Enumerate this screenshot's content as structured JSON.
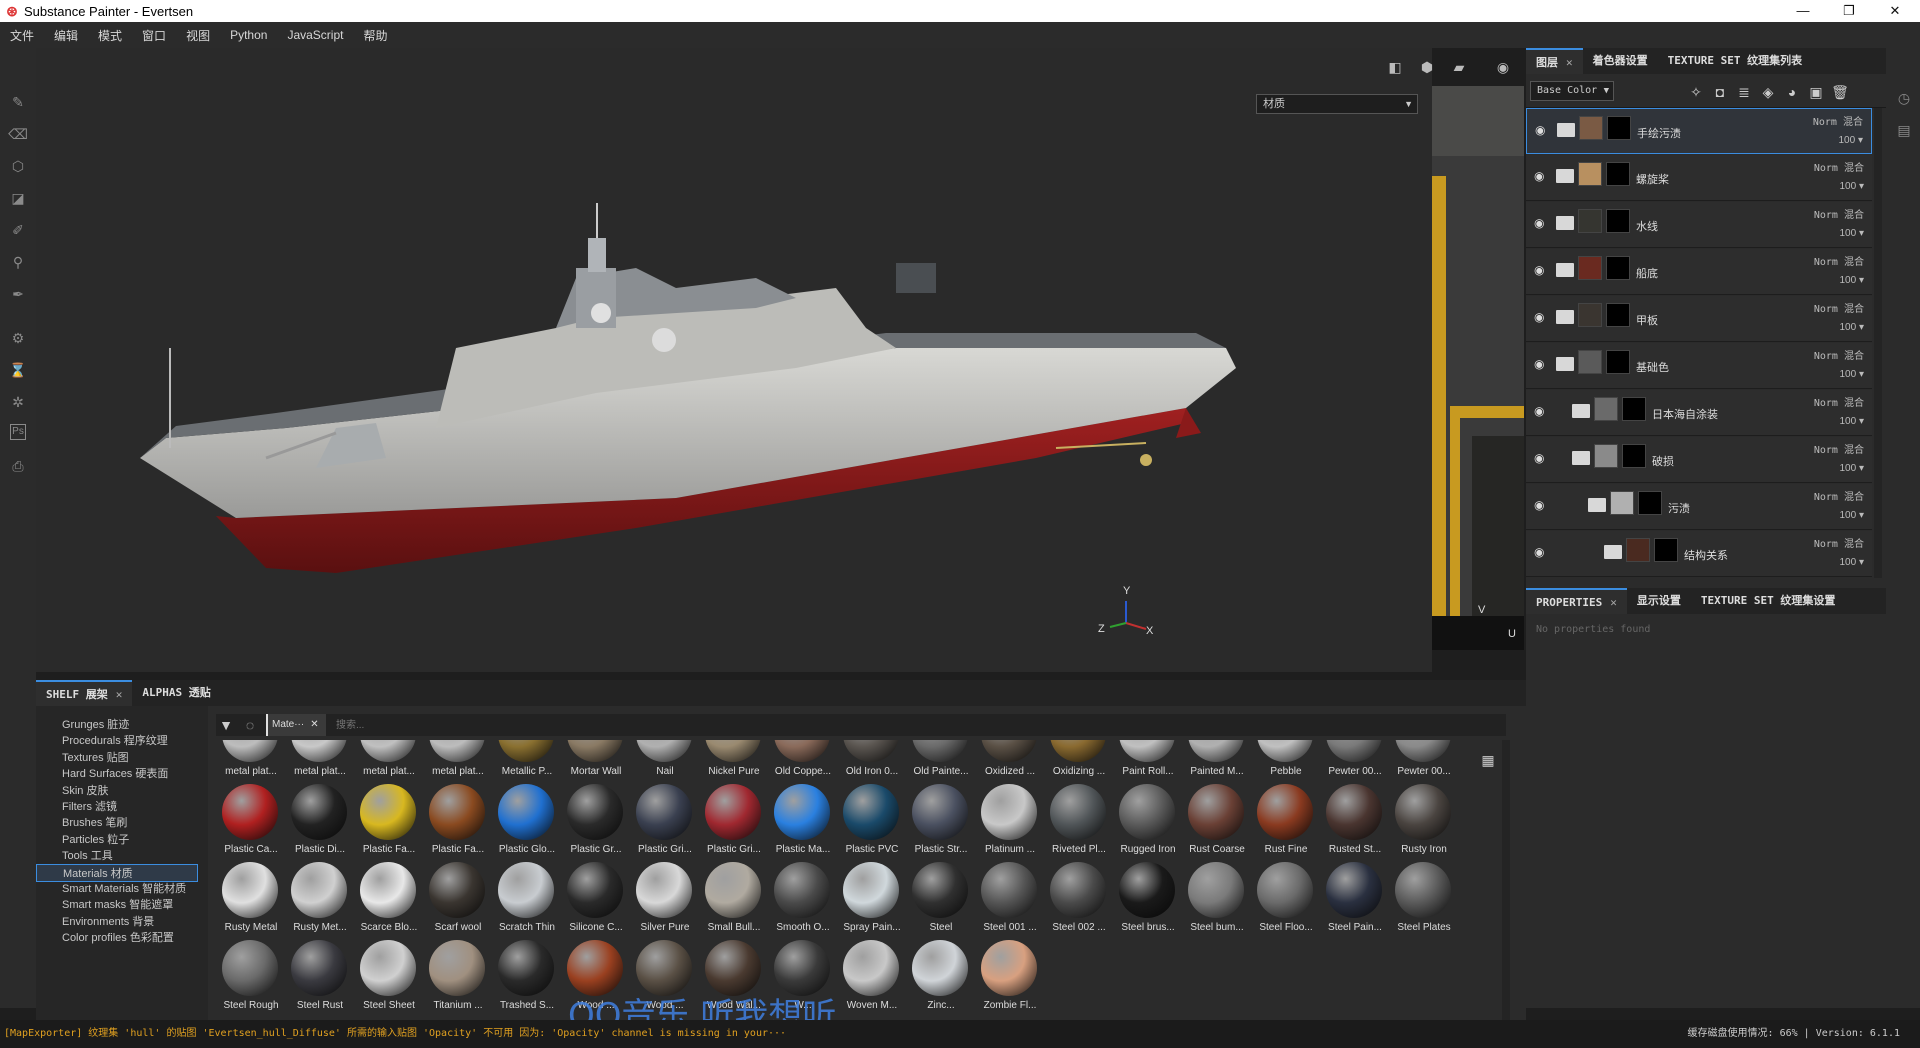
{
  "window": {
    "title": "Substance Painter - Evertsen",
    "logo": "⊛",
    "min": "—",
    "max": "❐",
    "close": "✕"
  },
  "menu": [
    "文件",
    "编辑",
    "模式",
    "窗口",
    "视图",
    "Python",
    "JavaScript",
    "帮助"
  ],
  "viewport": {
    "left_dropdown": "材质",
    "right_dropdown": "材质",
    "axis_y": "Y",
    "axis_z": "Z",
    "axis_x": "X",
    "uv_axis_v": "V",
    "uv_axis_u": "U"
  },
  "layers_panel": {
    "tabs": [
      {
        "label": "图层",
        "active": true
      },
      {
        "label": "着色器设置",
        "active": false
      },
      {
        "label": "TEXTURE SET 纹理集列表",
        "active": false
      }
    ],
    "channel": "Base Color",
    "layers": [
      {
        "name": "手绘污渍",
        "blend": "Norm",
        "blend_tag": "混合",
        "opacity": "100",
        "selected": true,
        "indent": 0,
        "thumb": "#7a5a44"
      },
      {
        "name": "螺旋桨",
        "blend": "Norm",
        "blend_tag": "混合",
        "opacity": "100",
        "selected": false,
        "indent": 0,
        "thumb": "#b89060"
      },
      {
        "name": "水线",
        "blend": "Norm",
        "blend_tag": "混合",
        "opacity": "100",
        "selected": false,
        "indent": 0,
        "thumb": "#353530"
      },
      {
        "name": "船底",
        "blend": "Norm",
        "blend_tag": "混合",
        "opacity": "100",
        "selected": false,
        "indent": 0,
        "thumb": "#6a2a20"
      },
      {
        "name": "甲板",
        "blend": "Norm",
        "blend_tag": "混合",
        "opacity": "100",
        "selected": false,
        "indent": 0,
        "thumb": "#3a3530"
      },
      {
        "name": "基础色",
        "blend": "Norm",
        "blend_tag": "混合",
        "opacity": "100",
        "selected": false,
        "indent": 0,
        "thumb": "#5a5a5a"
      },
      {
        "name": "日本海自涂装",
        "blend": "Norm",
        "blend_tag": "混合",
        "opacity": "100",
        "selected": false,
        "indent": 1,
        "thumb": "#6a6a6a"
      },
      {
        "name": "破损",
        "blend": "Norm",
        "blend_tag": "混合",
        "opacity": "100",
        "selected": false,
        "indent": 1,
        "thumb": "#8a8a8a"
      },
      {
        "name": "污渍",
        "blend": "Norm",
        "blend_tag": "混合",
        "opacity": "100",
        "selected": false,
        "indent": 2,
        "thumb": "#b0b0b0"
      },
      {
        "name": "结构关系",
        "blend": "Norm",
        "blend_tag": "混合",
        "opacity": "100",
        "selected": false,
        "indent": 3,
        "thumb": "#4a2a20"
      }
    ]
  },
  "properties_panel": {
    "tabs": [
      {
        "label": "PROPERTIES",
        "active": true
      },
      {
        "label": "显示设置",
        "active": false
      },
      {
        "label": "TEXTURE SET 纹理集设置",
        "active": false
      }
    ],
    "empty_text": "No properties found"
  },
  "shelf": {
    "tabs": [
      {
        "label": "SHELF 展架",
        "active": true
      },
      {
        "label": "ALPHAS 透贴",
        "active": false
      }
    ],
    "filter_chip": "Mate···",
    "search_placeholder": "搜索...",
    "categories": [
      {
        "label": "Grunges 脏迹"
      },
      {
        "label": "Procedurals 程序纹理"
      },
      {
        "label": "Textures 贴图"
      },
      {
        "label": "Hard Surfaces 硬表面"
      },
      {
        "label": "Skin 皮肤"
      },
      {
        "label": "Filters 滤镜"
      },
      {
        "label": "Brushes 笔刷"
      },
      {
        "label": "Particles 粒子"
      },
      {
        "label": "Tools 工具"
      },
      {
        "label": "Materials 材质",
        "selected": true
      },
      {
        "label": "Smart Materials 智能材质"
      },
      {
        "label": "Smart masks 智能遮罩"
      },
      {
        "label": "Environments 背景"
      },
      {
        "label": "Color profiles 色彩配置"
      }
    ],
    "materials": [
      [
        {
          "label": "metal plat...",
          "color": "#bdbdbd"
        },
        {
          "label": "metal plat...",
          "color": "#c8c8c8"
        },
        {
          "label": "metal plat...",
          "color": "#c0c0c0"
        },
        {
          "label": "metal plat...",
          "color": "#bcbcbc"
        },
        {
          "label": "Metallic P...",
          "color": "#8a7030"
        },
        {
          "label": "Mortar Wall",
          "color": "#8a7a64"
        },
        {
          "label": "Nail",
          "color": "#b0b0b0"
        },
        {
          "label": "Nickel Pure",
          "color": "#9a8a70"
        },
        {
          "label": "Old Coppe...",
          "color": "#8a6a5a"
        },
        {
          "label": "Old Iron 0...",
          "color": "#5a5550"
        },
        {
          "label": "Old Painte...",
          "color": "#6a6a6a"
        },
        {
          "label": "Oxidized ...",
          "color": "#5a5045"
        },
        {
          "label": "Oxidizing ...",
          "color": "#8a6a30"
        },
        {
          "label": "Paint Roll...",
          "color": "#c0c0c0"
        },
        {
          "label": "Painted M...",
          "color": "#b0b0b0"
        },
        {
          "label": "Pebble",
          "color": "#c0c0c0"
        },
        {
          "label": "Pewter 00...",
          "color": "#7a7a7a"
        },
        {
          "label": "Pewter 00...",
          "color": "#8a8a8a"
        }
      ],
      [
        {
          "label": "Plastic Ca...",
          "color": "#b02020"
        },
        {
          "label": "Plastic Di...",
          "color": "#222222"
        },
        {
          "label": "Plastic Fa...",
          "color": "#d8b820"
        },
        {
          "label": "Plastic Fa...",
          "color": "#8a4a20"
        },
        {
          "label": "Plastic Glo...",
          "color": "#2070d0"
        },
        {
          "label": "Plastic Gr...",
          "color": "#2a2a2a"
        },
        {
          "label": "Plastic Gri...",
          "color": "#3a4050"
        },
        {
          "label": "Plastic Gri...",
          "color": "#a02830"
        },
        {
          "label": "Plastic Ma...",
          "color": "#2a80e0"
        },
        {
          "label": "Plastic PVC",
          "color": "#1a4a6a"
        },
        {
          "label": "Plastic Str...",
          "color": "#4a5060"
        },
        {
          "label": "Platinum ...",
          "color": "#c8c8c8"
        },
        {
          "label": "Riveted Pl...",
          "color": "#505558"
        },
        {
          "label": "Rugged Iron",
          "color": "#5a5a5a"
        },
        {
          "label": "Rust Coarse",
          "color": "#6a4035"
        },
        {
          "label": "Rust Fine",
          "color": "#8a3a20"
        },
        {
          "label": "Rusted St...",
          "color": "#4a3530"
        },
        {
          "label": "Rusty Iron",
          "color": "#4a4440"
        }
      ],
      [
        {
          "label": "Rusty Metal",
          "color": "#e0e0e0"
        },
        {
          "label": "Rusty Met...",
          "color": "#d0d0d0"
        },
        {
          "label": "Scarce Blo...",
          "color": "#e8e8e8"
        },
        {
          "label": "Scarf wool",
          "color": "#3a3530"
        },
        {
          "label": "Scratch Thin",
          "color": "#c8ccd0"
        },
        {
          "label": "Silicone C...",
          "color": "#2a2a2a"
        },
        {
          "label": "Silver Pure",
          "color": "#d8d8d8"
        },
        {
          "label": "Small Bull...",
          "color": "#b0aaa0"
        },
        {
          "label": "Smooth O...",
          "color": "#4a4a4a"
        },
        {
          "label": "Spray Pain...",
          "color": "#d0d8dc"
        },
        {
          "label": "Steel",
          "color": "#303030"
        },
        {
          "label": "Steel 001 ...",
          "color": "#555555"
        },
        {
          "label": "Steel 002 ...",
          "color": "#4a4a4a"
        },
        {
          "label": "Steel brus...",
          "color": "#1a1a1a"
        },
        {
          "label": "Steel bum...",
          "color": "#7a7a7a"
        },
        {
          "label": "Steel Floo...",
          "color": "#6a6a6a"
        },
        {
          "label": "Steel Pain...",
          "color": "#2a3040"
        },
        {
          "label": "Steel Plates",
          "color": "#5a5a5a"
        }
      ],
      [
        {
          "label": "Steel Rough",
          "color": "#6a6a6a"
        },
        {
          "label": "Steel Rust",
          "color": "#3a3a40"
        },
        {
          "label": "Steel Sheet",
          "color": "#d0d0d0"
        },
        {
          "label": "Titanium ...",
          "color": "#a09080"
        },
        {
          "label": "Trashed S...",
          "color": "#2a2a2a"
        },
        {
          "label": "Wood ...",
          "color": "#9a4020"
        },
        {
          "label": "Wood ...",
          "color": "#5a5045"
        },
        {
          "label": "Wood Wal...",
          "color": "#4a3a30"
        },
        {
          "label": "W...",
          "color": "#3a3a3a"
        },
        {
          "label": "Woven M...",
          "color": "#c8c8c8"
        },
        {
          "label": "Zinc...",
          "color": "#d0d4d8"
        },
        {
          "label": "Zombie Fl...",
          "color": "#d8a080"
        }
      ]
    ]
  },
  "statusbar": {
    "message": "[MapExporter] 纹理集 'hull' 的贴图 'Evertsen_hull_Diffuse' 所需的输入贴图 'Opacity' 不可用 因为: 'Opacity' channel is missing in your···",
    "cache": "缓存磁盘使用情况:  66%",
    "version": "Version: 6.1.1"
  },
  "watermark": "QQ音乐 听我想听",
  "colors": {
    "accent": "#3b8de0",
    "orange": "#e07020",
    "panel": "#2b2b2b",
    "status_warning": "#e0a020"
  },
  "icons": [
    "paint-brush-icon",
    "eraser-icon",
    "projection-icon",
    "polygon-fill-icon",
    "smudge-icon",
    "clone-icon",
    "color-picker-icon",
    "settings-icon",
    "bake-icon",
    "texture-set-icon",
    "photoshop-icon",
    "export-icon",
    "camera-icon",
    "eye-icon",
    "folder-icon",
    "filter-icon",
    "grid-view-icon"
  ]
}
